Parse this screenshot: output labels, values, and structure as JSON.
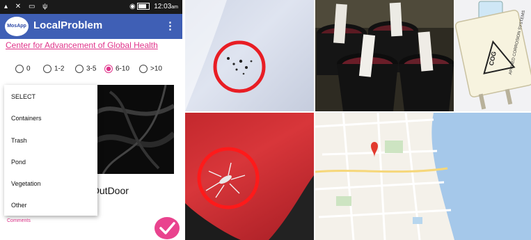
{
  "phone": {
    "status_time": "12:03",
    "status_am": "am",
    "app_logo_text": "MosApp",
    "app_title": "LocalProblem",
    "menu_icon": "more-vert-icon",
    "org_link": "Center for Advancement of Global Health",
    "count_options": [
      "0",
      "1-2",
      "3-5",
      "6-10",
      ">10"
    ],
    "selected_count": "6-10",
    "dropdown_items": [
      "SELECT",
      "Containers",
      "Trash",
      "Pond",
      "Vegetation",
      "Other"
    ],
    "location_text": "OutDoor",
    "comments_label": "Comments",
    "submit_icon": "check-icon",
    "accent_color": "#e0338a",
    "appbar_color": "#3f5fb5"
  },
  "device": {
    "brand_text": "COG",
    "label_text": "APPLIED CORROSION SYSTEMS"
  }
}
